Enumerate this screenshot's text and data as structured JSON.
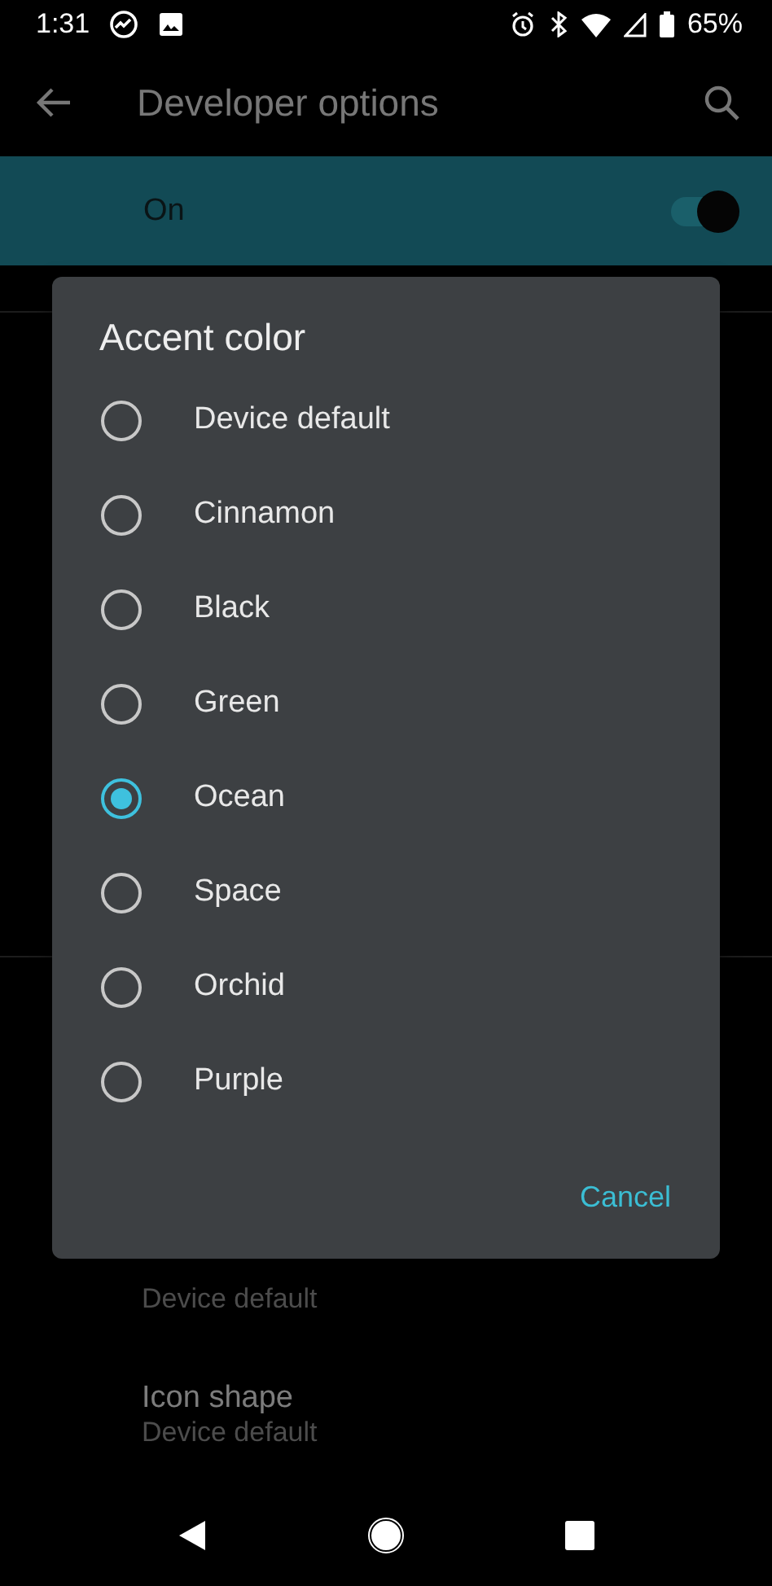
{
  "status_bar": {
    "time": "1:31",
    "battery": "65%"
  },
  "toolbar": {
    "title": "Developer options"
  },
  "master_switch": {
    "label": "On",
    "on": true
  },
  "settings": [
    {
      "title": "Icon shape",
      "summary": "Device default"
    }
  ],
  "settings_above": [
    {
      "summary": "Device default"
    }
  ],
  "dialog": {
    "title": "Accent color",
    "options": [
      {
        "label": "Device default",
        "selected": false
      },
      {
        "label": "Cinnamon",
        "selected": false
      },
      {
        "label": "Black",
        "selected": false
      },
      {
        "label": "Green",
        "selected": false
      },
      {
        "label": "Ocean",
        "selected": true
      },
      {
        "label": "Space",
        "selected": false
      },
      {
        "label": "Orchid",
        "selected": false
      },
      {
        "label": "Purple",
        "selected": false
      }
    ],
    "button": "Cancel"
  }
}
